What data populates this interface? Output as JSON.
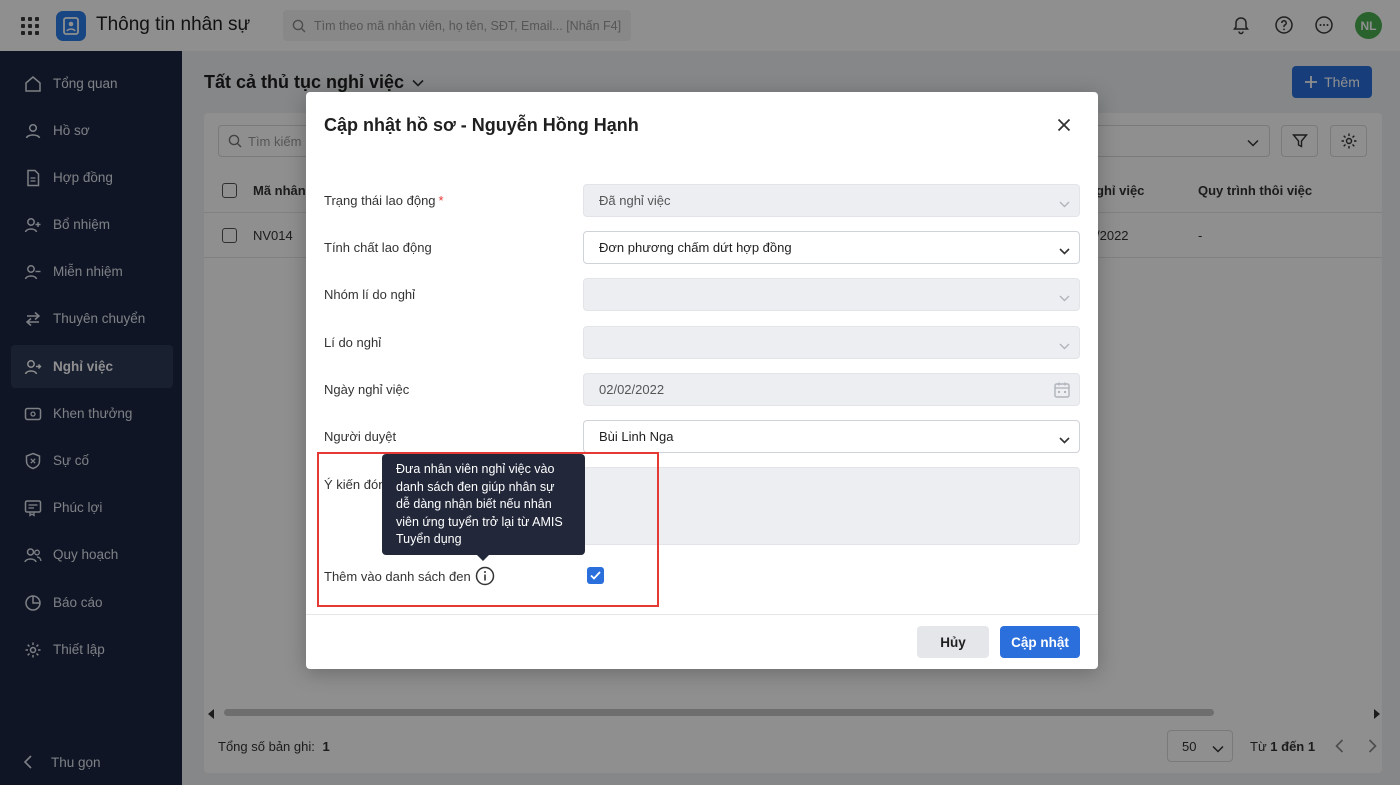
{
  "app": {
    "title": "Thông tin nhân sự",
    "avatar_initials": "NL"
  },
  "search": {
    "placeholder": "Tìm theo mã nhân viên, họ tên, SĐT, Email... [Nhấn F4]"
  },
  "sidebar": {
    "items": [
      {
        "label": "Tổng quan",
        "icon": "home-icon"
      },
      {
        "label": "Hồ sơ",
        "icon": "user-icon"
      },
      {
        "label": "Hợp đồng",
        "icon": "document-icon"
      },
      {
        "label": "Bổ nhiệm",
        "icon": "user-plus-icon"
      },
      {
        "label": "Miễn nhiệm",
        "icon": "user-minus-icon"
      },
      {
        "label": "Thuyên chuyển",
        "icon": "transfer-icon"
      },
      {
        "label": "Nghỉ việc",
        "icon": "user-leave-icon",
        "active": true
      },
      {
        "label": "Khen thưởng",
        "icon": "reward-icon"
      },
      {
        "label": "Sự cố",
        "icon": "incident-icon"
      },
      {
        "label": "Phúc lợi",
        "icon": "benefit-icon"
      },
      {
        "label": "Quy hoạch",
        "icon": "planning-icon"
      },
      {
        "label": "Báo cáo",
        "icon": "report-icon"
      },
      {
        "label": "Thiết lập",
        "icon": "settings-icon"
      }
    ],
    "collapse_label": "Thu gọn"
  },
  "page": {
    "title": "Tất cả thủ tục nghỉ việc",
    "add_label": "Thêm"
  },
  "list": {
    "search_placeholder": "Tìm kiếm",
    "columns": [
      "Mã nhân",
      "ghỉ việc",
      "Quy trình thôi việc"
    ],
    "rows": [
      {
        "code": "NV014",
        "date": "/2022",
        "process": "-"
      }
    ],
    "total_label": "Tổng số bản ghi:",
    "total_value": "1",
    "page_size": "50",
    "range_prefix": "Từ",
    "range_from": "1",
    "range_mid": "đến",
    "range_to": "1"
  },
  "modal": {
    "title": "Cập nhật hồ sơ - Nguyễn Hồng Hạnh",
    "fields": {
      "work_status": {
        "label": "Trạng thái lao động",
        "required": "*",
        "value": "Đã nghỉ việc"
      },
      "labor_nature": {
        "label": "Tính chất lao động",
        "value": "Đơn phương chấm dứt hợp đồng"
      },
      "reason_group": {
        "label": "Nhóm lí do nghỉ",
        "value": ""
      },
      "reason": {
        "label": "Lí do nghỉ",
        "value": ""
      },
      "leave_date": {
        "label": "Ngày nghỉ việc",
        "value": "02/02/2022"
      },
      "approver": {
        "label": "Người duyệt",
        "value": "Bùi Linh Nga"
      },
      "opinion": {
        "label": "Ý kiến đón",
        "value": ""
      },
      "blacklist": {
        "label": "Thêm vào danh sách đen",
        "checked": true
      }
    },
    "tooltip": "Đưa nhân viên nghỉ việc vào danh sách đen giúp nhân sự dễ dàng nhận biết nếu nhân viên ứng tuyển trở lại từ AMIS Tuyển dụng",
    "cancel_label": "Hủy",
    "submit_label": "Cập nhật"
  },
  "colors": {
    "sidebar": "#1b2640",
    "primary": "#2a6fdc",
    "highlight": "#e53935",
    "tooltip": "#22283a"
  }
}
